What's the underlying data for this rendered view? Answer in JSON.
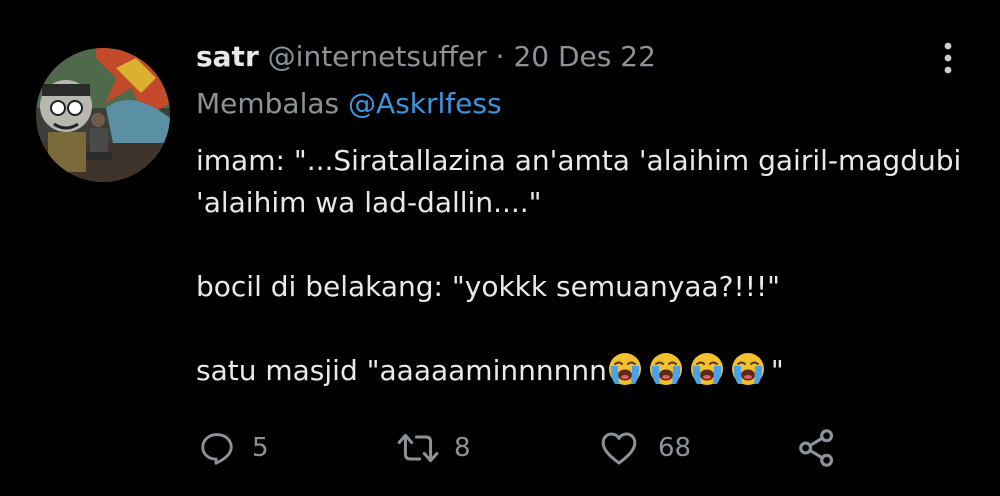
{
  "tweet": {
    "display_name": "satr",
    "handle": "@internetsuffer",
    "separator": "·",
    "date": "20 Des 22",
    "reply_prefix": "Membalas",
    "reply_to": "@Askrlfess",
    "lines": [
      "imam: \"...Siratallazina an'amta 'alaihim gairil-magdubi",
      "'alaihim wa lad-dallin....\"",
      "bocil di belakang: \"yokkk semuanyaa?!!!\"",
      "satu masjid \"aaaaaminnnnnn",
      "\""
    ],
    "emoji_count": 4,
    "emoji_name": "loudly-crying-face"
  },
  "actions": {
    "replies": "5",
    "retweets": "8",
    "likes": "68"
  },
  "icons": {
    "reply": "reply-icon",
    "retweet": "retweet-icon",
    "like": "heart-icon",
    "share": "share-icon",
    "more": "more-options-icon"
  },
  "colors": {
    "background": "#000000",
    "text": "#e7e9ea",
    "muted": "#8b9399",
    "link": "#3a96e0"
  }
}
